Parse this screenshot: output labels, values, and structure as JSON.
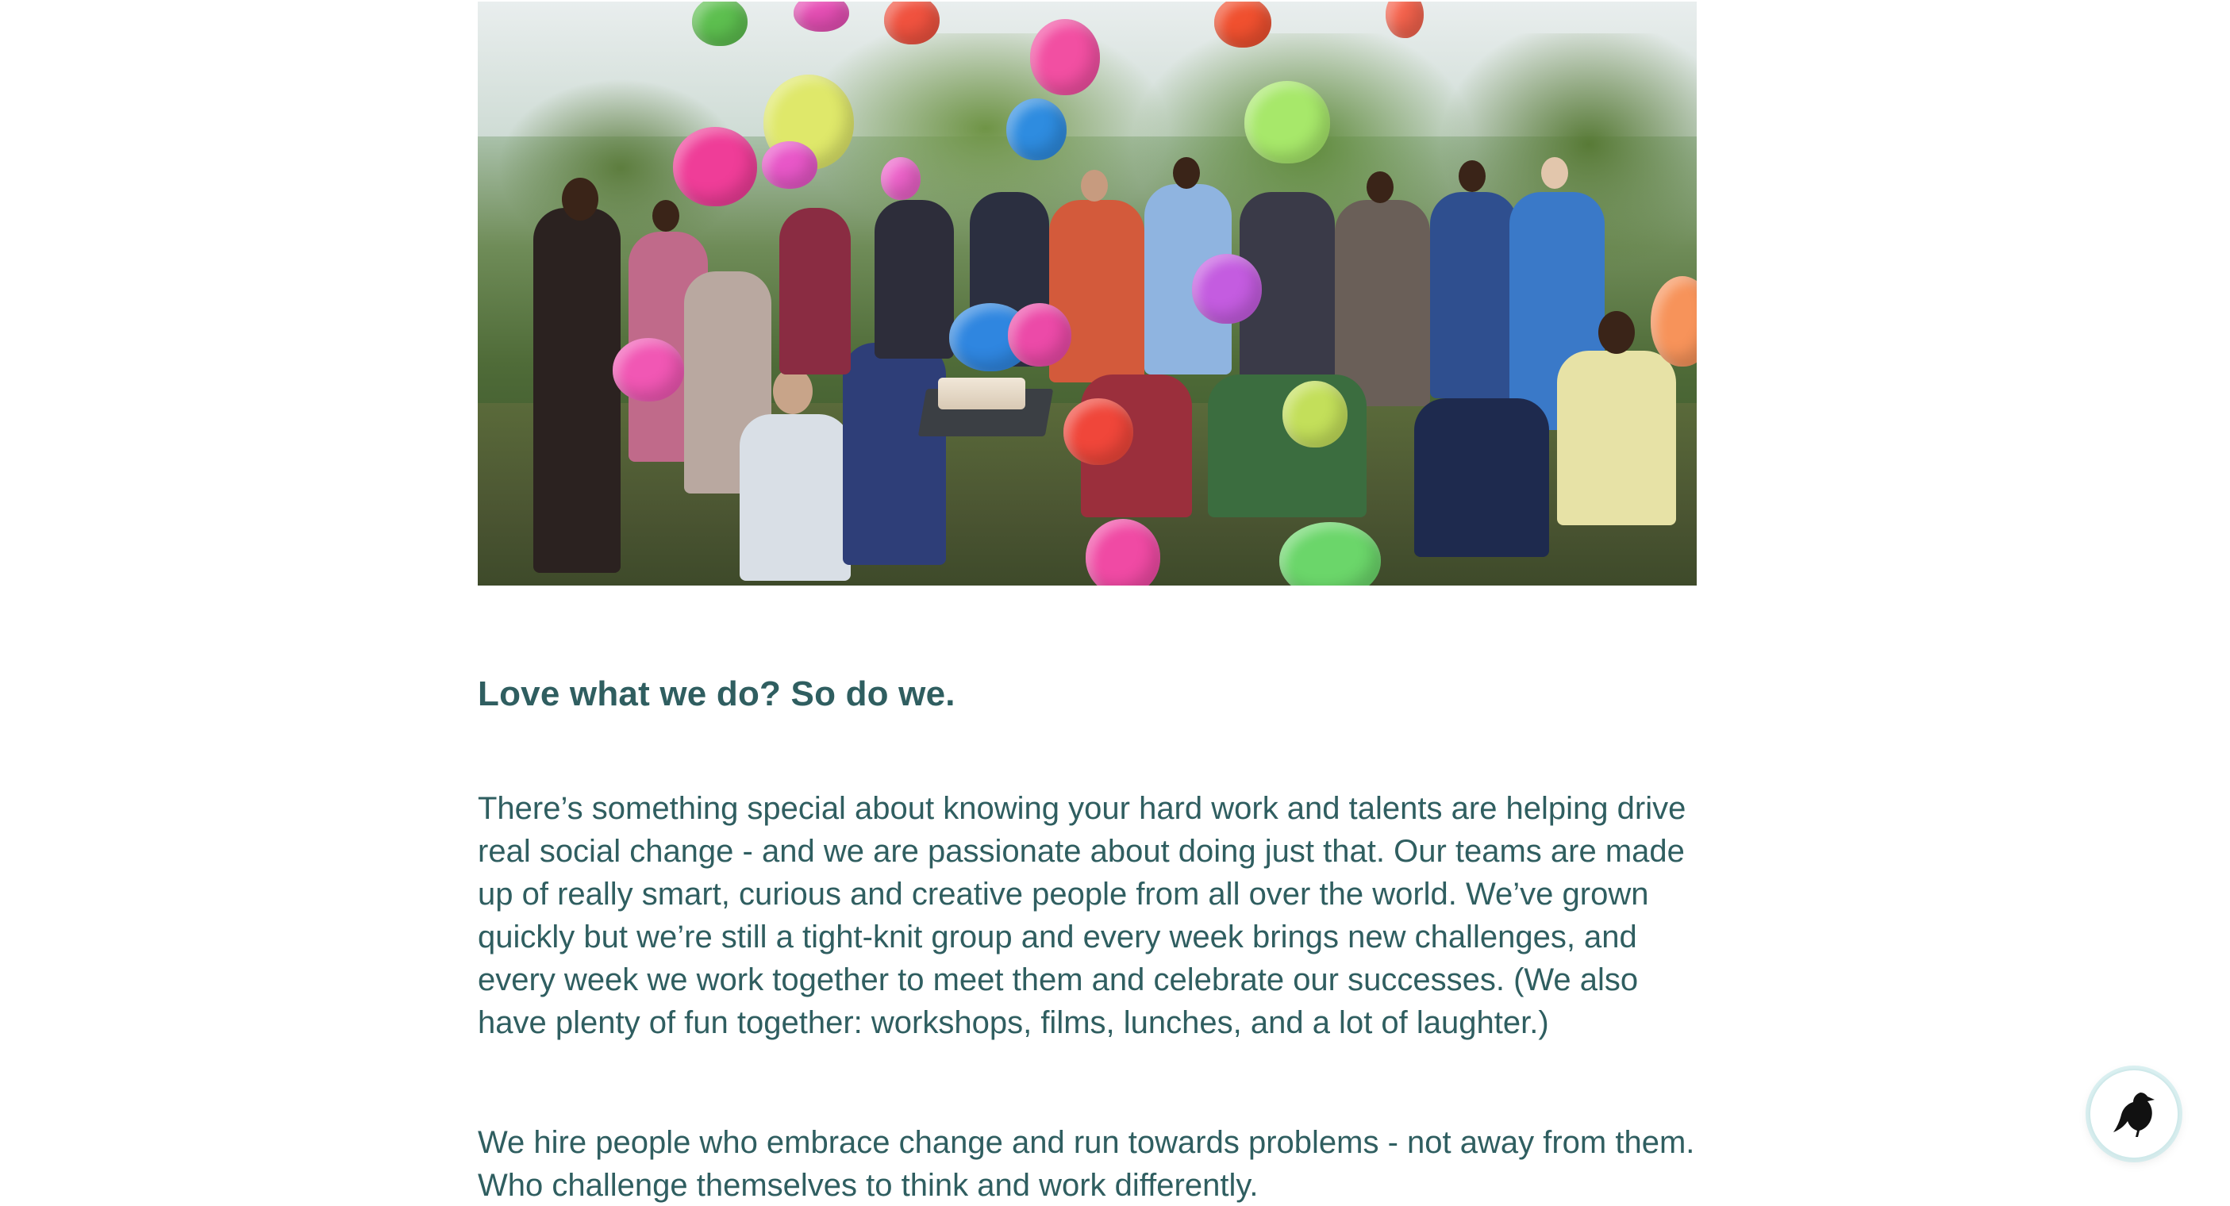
{
  "hero": {
    "alt": "Group photo of team celebrating outdoors with colorful balloons"
  },
  "section": {
    "heading": "Love what we do? So do we.",
    "paragraphs": [
      "There’s something special about knowing your hard work and talents are helping drive real social change - and we are passionate about doing just that. Our teams are made up of really smart, curious and creative people from all over the world. We’ve grown quickly but we’re still a tight-knit group and every week brings new challenges, and every week we work together to meet them and celebrate our successes. (We also have plenty of fun together: workshops, films, lunches, and a lot of laughter.)",
      "We hire people who embrace change and run towards problems - not away from them. Who challenge themselves to think and work differently."
    ]
  },
  "widgets": {
    "chat_icon": "bird-icon"
  },
  "colors": {
    "text": "#2f5e60",
    "background": "#ffffff"
  }
}
